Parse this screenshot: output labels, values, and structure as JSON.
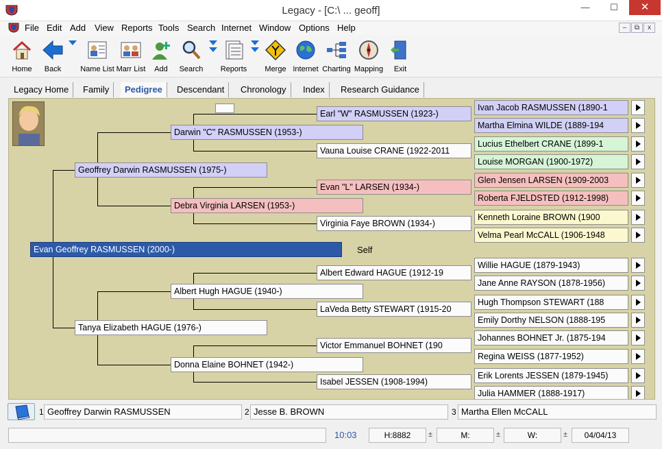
{
  "window": {
    "title": "Legacy - [C:\\ ... geoff]",
    "minimize": "—",
    "maximize": "☐",
    "close": "✕"
  },
  "menu": [
    "File",
    "Edit",
    "Add",
    "View",
    "Reports",
    "Tools",
    "Search",
    "Internet",
    "Window",
    "Options",
    "Help"
  ],
  "mdi": {
    "minimize": "–",
    "restore": "⧉",
    "close": "x"
  },
  "toolbar": [
    {
      "label": "Home",
      "icon": "home-icon"
    },
    {
      "label": "Back",
      "icon": "back-arrow-icon"
    },
    {
      "label": "Name List",
      "icon": "name-list-icon"
    },
    {
      "label": "Marr List",
      "icon": "marriage-list-icon"
    },
    {
      "label": "Add",
      "icon": "add-person-icon"
    },
    {
      "label": "Search",
      "icon": "search-icon"
    },
    {
      "label": "Reports",
      "icon": "reports-icon"
    },
    {
      "label": "Merge",
      "icon": "merge-icon"
    },
    {
      "label": "Internet",
      "icon": "globe-icon"
    },
    {
      "label": "Charting",
      "icon": "chart-icon"
    },
    {
      "label": "Mapping",
      "icon": "compass-icon"
    },
    {
      "label": "Exit",
      "icon": "exit-door-icon"
    }
  ],
  "tabs": [
    "Legacy Home",
    "Family",
    "Pedigree",
    "Descendant",
    "Chronology",
    "Index",
    "Research Guidance"
  ],
  "active_tab": "Pedigree",
  "pedigree": {
    "photo_icon": "child-photo",
    "self_label": "Self",
    "gen1": {
      "name": "Evan Geoffrey RASMUSSEN (2000-)"
    },
    "gen2": [
      {
        "name": "Geoffrey Darwin RASMUSSEN (1975-)"
      },
      {
        "name": "Tanya Elizabeth HAGUE (1976-)"
      }
    ],
    "gen3": [
      {
        "name": "Darwin \"C\" RASMUSSEN (1953-)"
      },
      {
        "name": "Debra Virginia LARSEN (1953-)"
      },
      {
        "name": "Albert Hugh HAGUE (1940-)"
      },
      {
        "name": "Donna Elaine BOHNET (1942-)"
      }
    ],
    "gen4": [
      {
        "name": "Earl \"W\" RASMUSSEN (1923-)"
      },
      {
        "name": "Vauna Louise CRANE (1922-2011"
      },
      {
        "name": "Evan \"L\" LARSEN (1934-)"
      },
      {
        "name": "Virginia Faye BROWN (1934-)"
      },
      {
        "name": "Albert Edward HAGUE (1912-19"
      },
      {
        "name": "LaVeda Betty STEWART (1915-20"
      },
      {
        "name": "Victor Emmanuel BOHNET (190"
      },
      {
        "name": "Isabel JESSEN (1908-1994)"
      }
    ],
    "gen5": [
      {
        "name": "Ivan Jacob RASMUSSEN (1890-1"
      },
      {
        "name": "Martha Elmina WILDE (1889-194"
      },
      {
        "name": "Lucius Ethelbert CRANE (1899-1"
      },
      {
        "name": "Louise MORGAN (1900-1972)"
      },
      {
        "name": "Glen Jensen LARSEN (1909-2003"
      },
      {
        "name": "Roberta FJELDSTED (1912-1998)"
      },
      {
        "name": "Kenneth Loraine BROWN (1900"
      },
      {
        "name": "Velma Pearl McCALL (1906-1948"
      },
      {
        "name": "Willie HAGUE (1879-1943)"
      },
      {
        "name": "Jane Anne RAYSON (1878-1956)"
      },
      {
        "name": "Hugh Thompson STEWART (188"
      },
      {
        "name": "Emily Dorthy NELSON (1888-195"
      },
      {
        "name": "Johannes BOHNET Jr. (1875-194"
      },
      {
        "name": "Regina WEISS (1877-1952)"
      },
      {
        "name": "Erik Lorents JESSEN (1879-1945)"
      },
      {
        "name": "Julia HAMMER (1888-1917)"
      }
    ]
  },
  "siblings": [
    {
      "num": "1",
      "name": "Geoffrey Darwin RASMUSSEN"
    },
    {
      "num": "2",
      "name": "Jesse B. BROWN"
    },
    {
      "num": "3",
      "name": "Martha Ellen McCALL"
    }
  ],
  "status": {
    "time": "10:03",
    "h": "H:8882",
    "m": "M:",
    "w": "W:",
    "date": "04/04/13",
    "pm": "±"
  },
  "colors": {
    "self": "#2c5aa8",
    "male": "#d2d0f7",
    "female": "#f6bfbf",
    "background": "#d7d3a6"
  }
}
